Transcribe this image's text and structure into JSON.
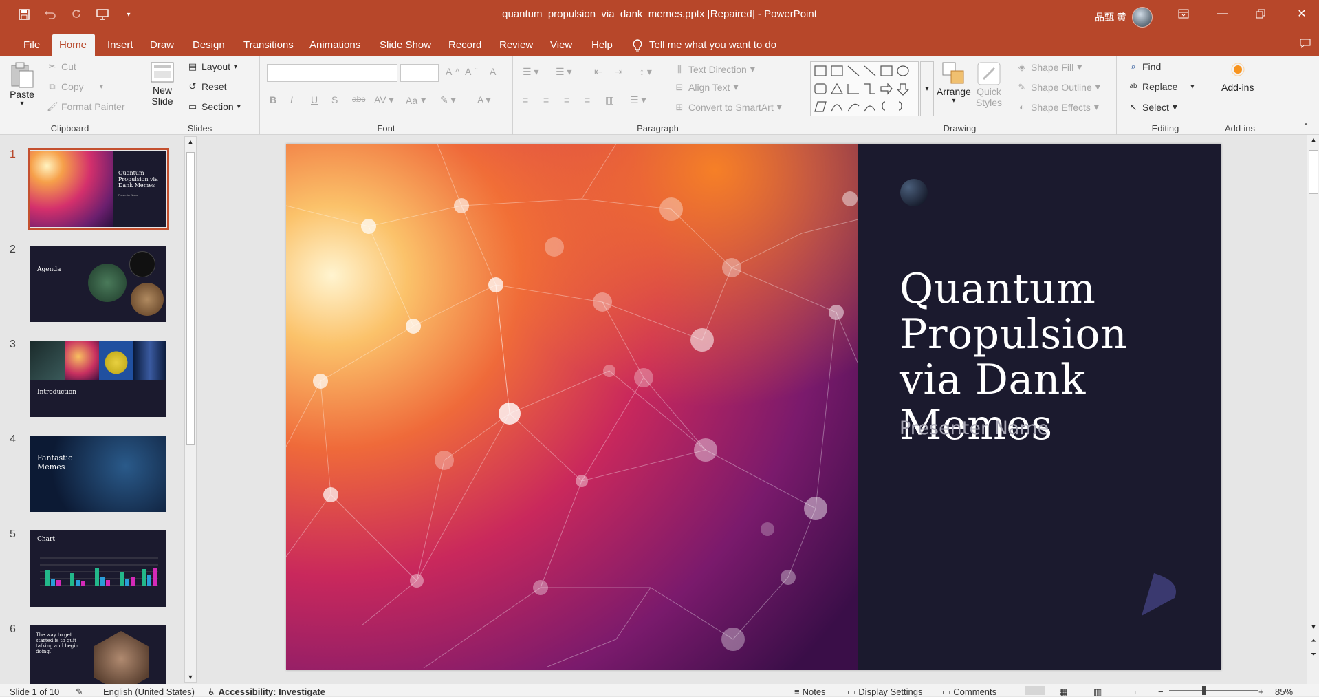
{
  "window": {
    "title": "quantum_propulsion_via_dank_memes.pptx [Repaired]  -  PowerPoint",
    "user": "品甄 黄",
    "accent": "#b7472a"
  },
  "qat": {
    "save_icon": "save-icon",
    "undo_icon": "undo-icon",
    "redo_icon": "redo-icon",
    "present_icon": "present-icon",
    "customize_icon": "chevron-down-icon"
  },
  "menu": {
    "tabs": [
      "File",
      "Home",
      "Insert",
      "Draw",
      "Design",
      "Transitions",
      "Animations",
      "Slide Show",
      "Record",
      "Review",
      "View",
      "Help"
    ],
    "active": "Home",
    "tell_me": "Tell me what you want to do"
  },
  "ribbon": {
    "clipboard": {
      "paste": "Paste",
      "cut": "Cut",
      "copy": "Copy",
      "format_painter": "Format Painter",
      "label": "Clipboard"
    },
    "slides": {
      "new_slide": "New Slide",
      "layout": "Layout",
      "reset": "Reset",
      "section": "Section",
      "label": "Slides"
    },
    "font": {
      "label": "Font",
      "bold": "B",
      "italic": "I",
      "underline": "U",
      "shadow": "S",
      "strike": "abc",
      "case": "Aa"
    },
    "paragraph": {
      "text_direction": "Text Direction",
      "align_text": "Align Text",
      "smartart": "Convert to SmartArt",
      "label": "Paragraph"
    },
    "drawing": {
      "arrange": "Arrange",
      "quick_styles": "Quick Styles",
      "shape_fill": "Shape Fill",
      "shape_outline": "Shape Outline",
      "shape_effects": "Shape Effects",
      "label": "Drawing"
    },
    "editing": {
      "find": "Find",
      "replace": "Replace",
      "select": "Select",
      "label": "Editing"
    },
    "addins": {
      "addins": "Add-ins",
      "label": "Add-ins"
    }
  },
  "thumbnails": [
    {
      "num": "1",
      "title": "Quantum Propulsion via Dank Memes",
      "sub": "Presenter Name"
    },
    {
      "num": "2",
      "title": "Agenda"
    },
    {
      "num": "3",
      "title": "Introduction"
    },
    {
      "num": "4",
      "title": "Fantastic Memes"
    },
    {
      "num": "5",
      "title": "Chart"
    },
    {
      "num": "6",
      "title": "The way to get started is to quit talking and begin doing."
    }
  ],
  "slide": {
    "title": "Quantum Propulsion via Dank Memes",
    "presenter": "Presenter Name"
  },
  "status": {
    "slide_of": "Slide 1 of 10",
    "language": "English (United States)",
    "accessibility": "Accessibility: Investigate",
    "notes": "Notes",
    "display_settings": "Display Settings",
    "comments": "Comments",
    "zoom": "85%"
  }
}
